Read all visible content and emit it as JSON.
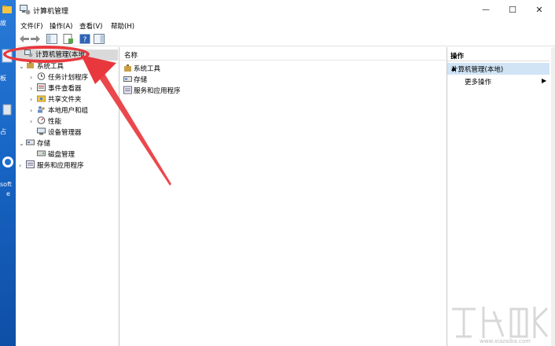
{
  "desktop": {
    "labels": [
      "故",
      "板",
      "占",
      "soft",
      "e"
    ]
  },
  "window": {
    "title": "计算机管理",
    "minimize_glyph": "—",
    "maximize_glyph": "☐",
    "close_glyph": "✕"
  },
  "menu": {
    "items": [
      "文件(F)",
      "操作(A)",
      "查看(V)",
      "帮助(H)"
    ]
  },
  "tree": {
    "root": "计算机管理(本地)",
    "system_tools": "系统工具",
    "task_scheduler": "任务计划程序",
    "event_viewer": "事件查看器",
    "shared_folders": "共享文件夹",
    "local_users": "本地用户和组",
    "performance": "性能",
    "device_manager": "设备管理器",
    "storage": "存储",
    "disk_management": "磁盘管理",
    "services_apps": "服务和应用程序",
    "expand_glyph": "›",
    "collapse_glyph": "⌄"
  },
  "list": {
    "column_name": "名称",
    "items": [
      "系统工具",
      "存储",
      "服务和应用程序"
    ]
  },
  "actions": {
    "header": "操作",
    "section": "计算机管理(本地)",
    "section_arrow": "▲",
    "more": "更多操作",
    "more_arrow": "▶"
  },
  "watermark": {
    "url": "www.xiazaiba.com"
  },
  "colors": {
    "annotation_red": "#e8383d",
    "selection_blue": "#d0e4f5"
  }
}
